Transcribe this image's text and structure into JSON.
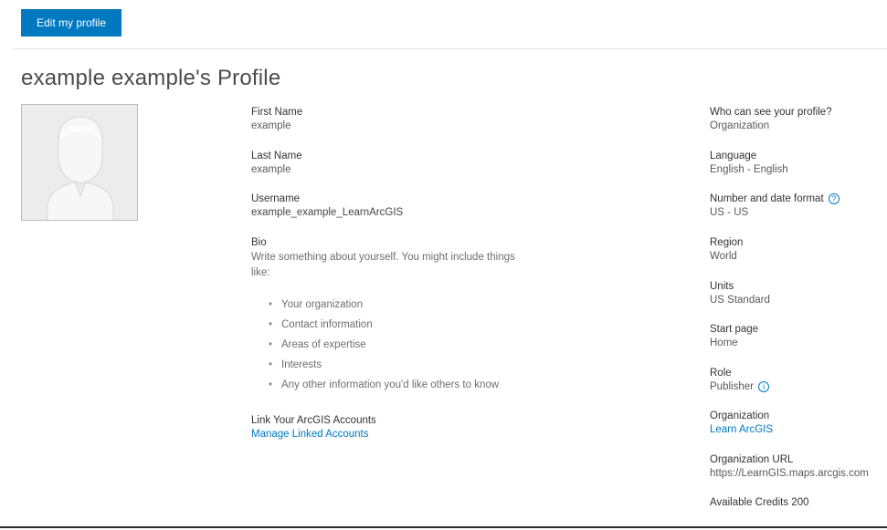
{
  "header": {
    "edit_button_label": "Edit my profile"
  },
  "profile": {
    "title": "example example's Profile",
    "avatar": "default-user-silhouette"
  },
  "details": {
    "first_name_label": "First Name",
    "first_name_value": "example",
    "last_name_label": "Last Name",
    "last_name_value": "example",
    "username_label": "Username",
    "username_value": "example_example_LearnArcGIS",
    "bio_label": "Bio",
    "bio_placeholder": "Write something about yourself. You might include things like:",
    "bio_items": [
      "Your organization",
      "Contact information",
      "Areas of expertise",
      "Interests",
      "Any other information you'd like others to know"
    ],
    "link_accounts_label": "Link Your ArcGIS Accounts",
    "link_accounts_link": "Manage Linked Accounts"
  },
  "settings": {
    "visibility_label": "Who can see your profile?",
    "visibility_value": "Organization",
    "language_label": "Language",
    "language_value": "English - English",
    "number_format_label": "Number and date format",
    "number_format_value": "US - US",
    "region_label": "Region",
    "region_value": "World",
    "units_label": "Units",
    "units_value": "US Standard",
    "start_page_label": "Start page",
    "start_page_value": "Home",
    "role_label": "Role",
    "role_value": "Publisher",
    "organization_label": "Organization",
    "organization_value": "Learn ArcGIS",
    "org_url_label": "Organization URL",
    "org_url_value": "https://LearnGIS.maps.arcgis.com",
    "credits_label": "Available Credits",
    "credits_value": "200"
  },
  "colors": {
    "accent": "#0079c1",
    "text": "#4c4c4c",
    "avatar_bg": "#ececec"
  }
}
